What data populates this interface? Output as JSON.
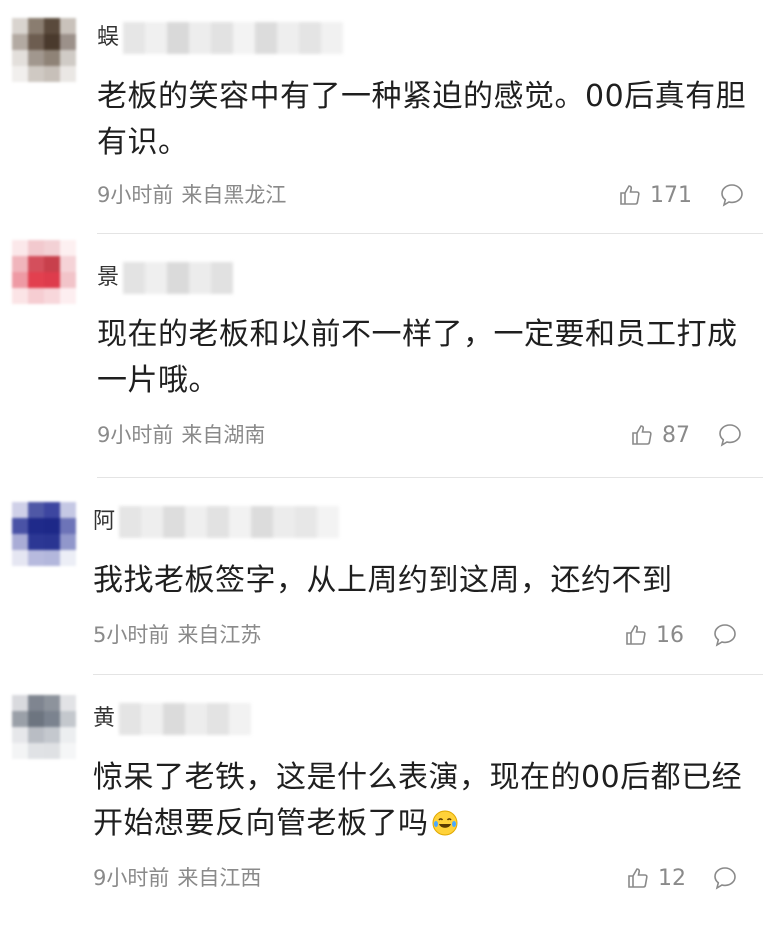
{
  "comments": [
    {
      "name_initial": "蜈",
      "text": "老板的笑容中有了一种紧迫的感觉。00后真有胆有识。",
      "time": "9小时前",
      "location": "来自黑龙江",
      "likes": "171",
      "avatar_colors": [
        "#d9d4cf",
        "#8a7d70",
        "#5a4a3c",
        "#c9c2bb",
        "#b3aaa2",
        "#6d5d50",
        "#4a3a2d",
        "#9c918a",
        "#e3dfdb",
        "#a1978e",
        "#8f8377",
        "#d0cbc6",
        "#f1efed",
        "#cfc9c3",
        "#c7c0b9",
        "#eae7e4"
      ]
    },
    {
      "name_initial": "景",
      "text": "现在的老板和以前不一样了，一定要和员工打成一片哦。",
      "time": "9小时前",
      "location": "来自湖南",
      "likes": "87",
      "avatar_colors": [
        "#fbe8ea",
        "#f2c9ce",
        "#f3d1d5",
        "#fdf0f1",
        "#f0b5bc",
        "#d44f5c",
        "#c8404c",
        "#f5d3d7",
        "#ee9aa4",
        "#e2404f",
        "#de3c4c",
        "#f2c4c9",
        "#fbe4e6",
        "#f6cdd2",
        "#f8d7db",
        "#fdeef0"
      ]
    },
    {
      "name_initial": "阿",
      "text": "我找老板签字，从上周约到这周，还约不到",
      "time": "5小时前",
      "location": "来自江苏",
      "likes": "16",
      "avatar_colors": [
        "#cfd0e8",
        "#4f58a6",
        "#3d46a0",
        "#c5c8e4",
        "#4a53a6",
        "#1f2a8a",
        "#1d2888",
        "#6d74b8",
        "#a9acd6",
        "#2c3794",
        "#2a3592",
        "#9197cb",
        "#e5e6f2",
        "#b7bade",
        "#b3b7dc",
        "#eceef6"
      ]
    },
    {
      "name_initial": "黄",
      "text": "惊呆了老铁，这是什么表演，现在的00后都已经开始想要反向管老板了吗",
      "time": "9小时前",
      "location": "来自江西",
      "likes": "12",
      "avatar_colors": [
        "#d9dade",
        "#7f8590",
        "#8d939c",
        "#e2e3e6",
        "#9aa0a8",
        "#6d7580",
        "#7b838f",
        "#c4c8cd",
        "#e6e7ea",
        "#b9bdc4",
        "#c4c8ce",
        "#eceef0",
        "#f3f4f5",
        "#e0e2e5",
        "#dfe1e4",
        "#f5f6f7"
      ]
    }
  ],
  "icons": {
    "like": "thumbs-up-icon",
    "reply": "comment-bubble-icon",
    "emoji": "laughing-tears-emoji"
  }
}
